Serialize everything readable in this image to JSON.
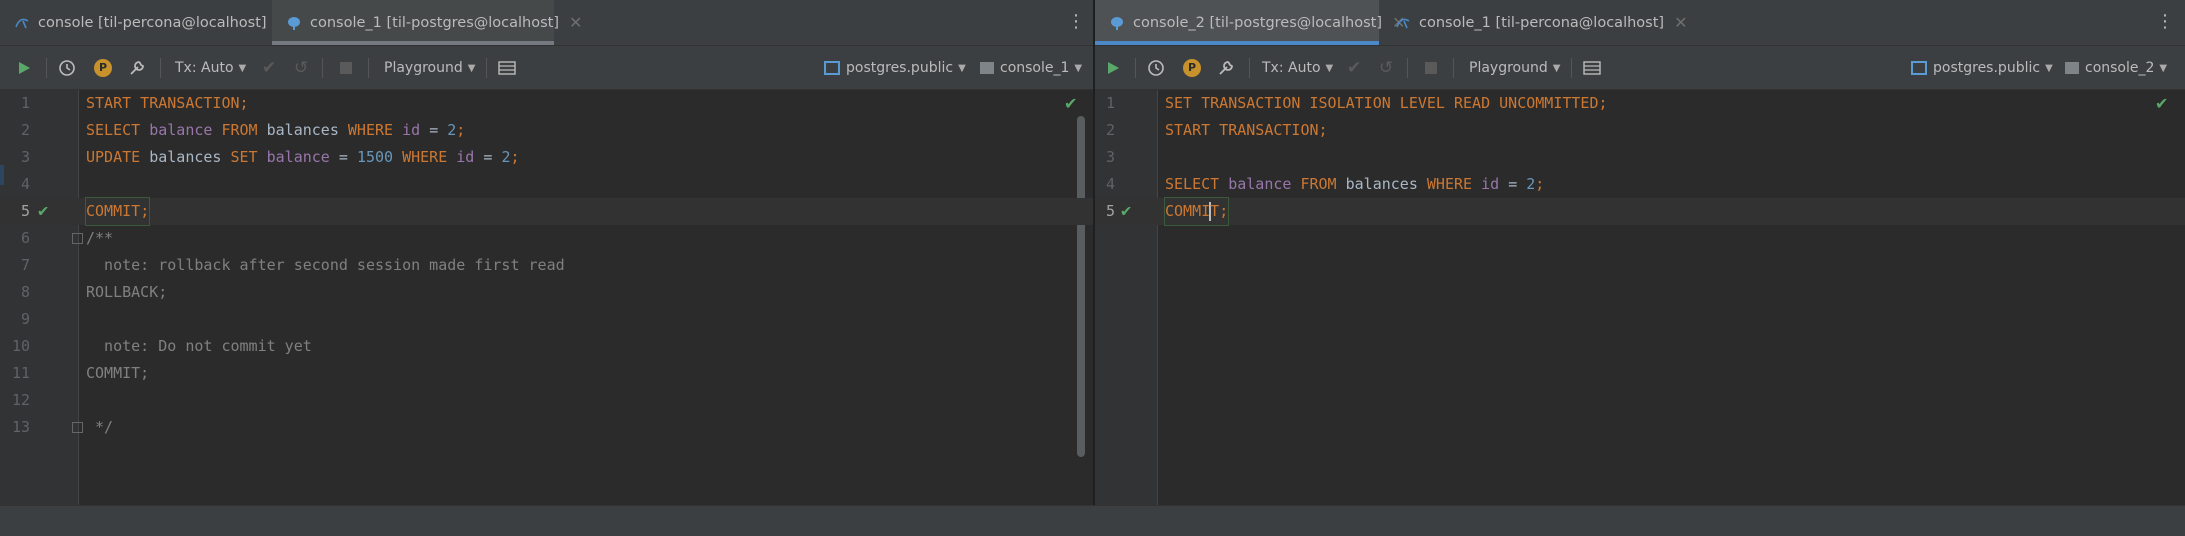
{
  "left": {
    "tabs": [
      {
        "label": "console [til-percona@localhost]",
        "icon": "mysql-icon"
      },
      {
        "label": "console_1 [til-postgres@localhost]",
        "icon": "postgres-icon"
      }
    ],
    "toolbar": {
      "tx_mode": "Tx: Auto",
      "playground": "Playground",
      "schema": "postgres.public",
      "session": "console_1",
      "pending_badge": "P"
    },
    "lines": [
      {
        "n": "1"
      },
      {
        "n": "2"
      },
      {
        "n": "3"
      },
      {
        "n": "4"
      },
      {
        "n": "5"
      },
      {
        "n": "6"
      },
      {
        "n": "7"
      },
      {
        "n": "8"
      },
      {
        "n": "9"
      },
      {
        "n": "10"
      },
      {
        "n": "11"
      },
      {
        "n": "12"
      },
      {
        "n": "13"
      }
    ],
    "code": {
      "l1": [
        "START TRANSACTION",
        ";"
      ],
      "l2": [
        "SELECT",
        "balance",
        "FROM",
        "balances",
        "WHERE",
        "id",
        "=",
        "2",
        ";"
      ],
      "l3": [
        "UPDATE",
        "balances",
        "SET",
        "balance",
        "=",
        "1500",
        "WHERE",
        "id",
        "=",
        "2",
        ";"
      ],
      "l5": [
        "COMMIT",
        ";"
      ],
      "l6": "/**",
      "l7": "  note: rollback after second session made first read",
      "l8": "ROLLBACK;",
      "l10": "  note: Do not commit yet",
      "l11": "COMMIT;",
      "l13": " */"
    }
  },
  "right": {
    "tabs": [
      {
        "label": "console_2 [til-postgres@localhost]",
        "icon": "postgres-icon"
      },
      {
        "label": "console_1 [til-percona@localhost]",
        "icon": "mysql-icon"
      }
    ],
    "toolbar": {
      "tx_mode": "Tx: Auto",
      "playground": "Playground",
      "schema": "postgres.public",
      "session": "console_2",
      "pending_badge": "P"
    },
    "lines": [
      {
        "n": "1"
      },
      {
        "n": "2"
      },
      {
        "n": "3"
      },
      {
        "n": "4"
      },
      {
        "n": "5"
      }
    ],
    "code": {
      "l1": [
        "SET TRANSACTION ISOLATION LEVEL READ UNCOMMITTED",
        ";"
      ],
      "l2": [
        "START TRANSACTION",
        ";"
      ],
      "l4": [
        "SELECT",
        "balance",
        "FROM",
        "balances",
        "WHERE",
        "id",
        "=",
        "2",
        ";"
      ],
      "l5a": "COMMI",
      "l5b": "T",
      "l5c": ";"
    }
  },
  "colors": {
    "keyword": "#cc7832",
    "identifier": "#9876aa",
    "number": "#6897bb",
    "comment": "#808080",
    "success": "#59a869",
    "accent": "#4a88c7"
  }
}
